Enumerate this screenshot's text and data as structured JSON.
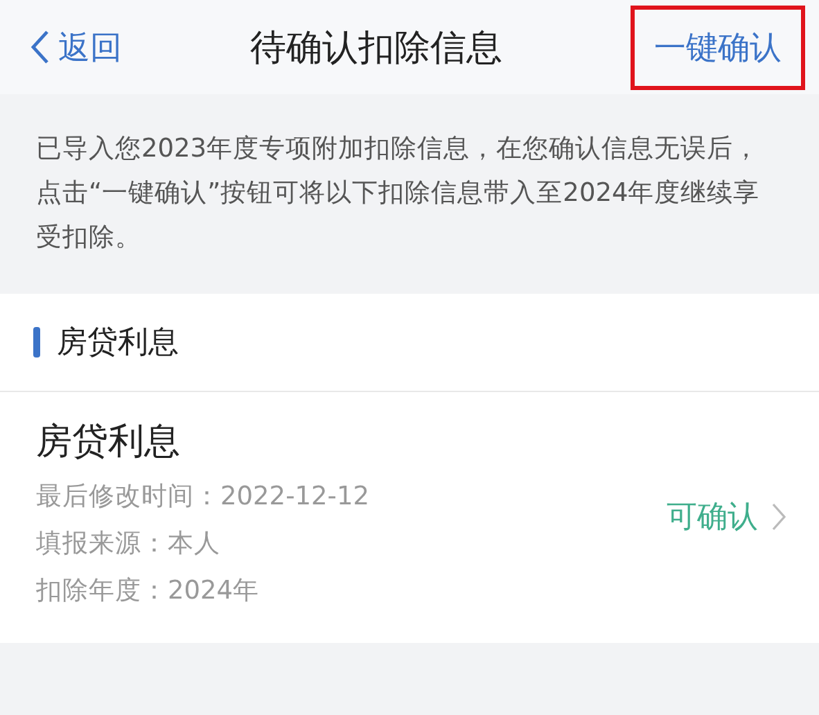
{
  "header": {
    "back": "返回",
    "title": "待确认扣除信息",
    "action": {
      "label": "一键确认",
      "highlighted": true
    }
  },
  "notice": "已导入您2023年度专项附加扣除信息，在您确认信息无误后，点击“一键确认”按钮可将以下扣除信息带入至2024年度继续享受扣除。",
  "section": {
    "title": "房贷利息"
  },
  "items": [
    {
      "name": "房贷利息",
      "details": [
        "最后修改时间：2022-12-12",
        "填报来源：本人",
        "扣除年度：2024年"
      ],
      "status": "可确认"
    }
  ]
}
